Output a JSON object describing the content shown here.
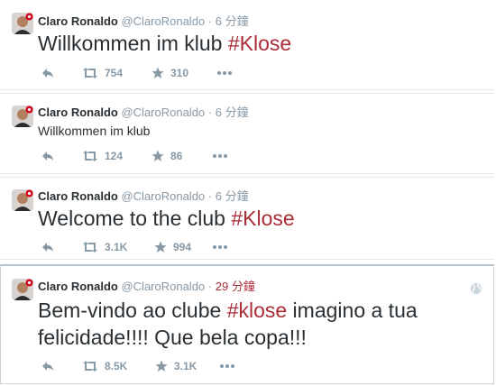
{
  "tweets": [
    {
      "name": "Claro Ronaldo",
      "handle": "@ClaroRonaldo",
      "separator": "·",
      "time": "6 分鐘",
      "text_pre": "Willkommen im klub ",
      "hashtag": "#Klose",
      "text_post": "",
      "retweets": "754",
      "favorites": "310"
    },
    {
      "name": "Claro Ronaldo",
      "handle": "@ClaroRonaldo",
      "separator": "·",
      "time": "6 分鐘",
      "text_pre": "Willkommen im klub",
      "hashtag": "",
      "text_post": "",
      "retweets": "124",
      "favorites": "86"
    },
    {
      "name": "Claro Ronaldo",
      "handle": "@ClaroRonaldo",
      "separator": "·",
      "time": "6 分鐘",
      "text_pre": "Welcome to the club ",
      "hashtag": "#Klose",
      "text_post": "",
      "retweets": "3.1K",
      "favorites": "994"
    },
    {
      "name": "Claro Ronaldo",
      "handle": "@ClaroRonaldo",
      "separator": "·",
      "time": "29 分鐘",
      "text_pre": "Bem-vindo ao clube ",
      "hashtag": "#klose",
      "text_post": " imagino a tua",
      "text_line2": "felicidade!!!! Que bela copa!!!",
      "retweets": "8.5K",
      "favorites": "3.1K"
    }
  ],
  "icons": {
    "reply": "reply-icon",
    "retweet": "retweet-icon",
    "favorite": "star-icon",
    "more": "more-icon",
    "globe": "globe-icon"
  },
  "colors": {
    "hashtag": "#aa2c37",
    "meta": "#8899a6",
    "text": "#292f33"
  }
}
